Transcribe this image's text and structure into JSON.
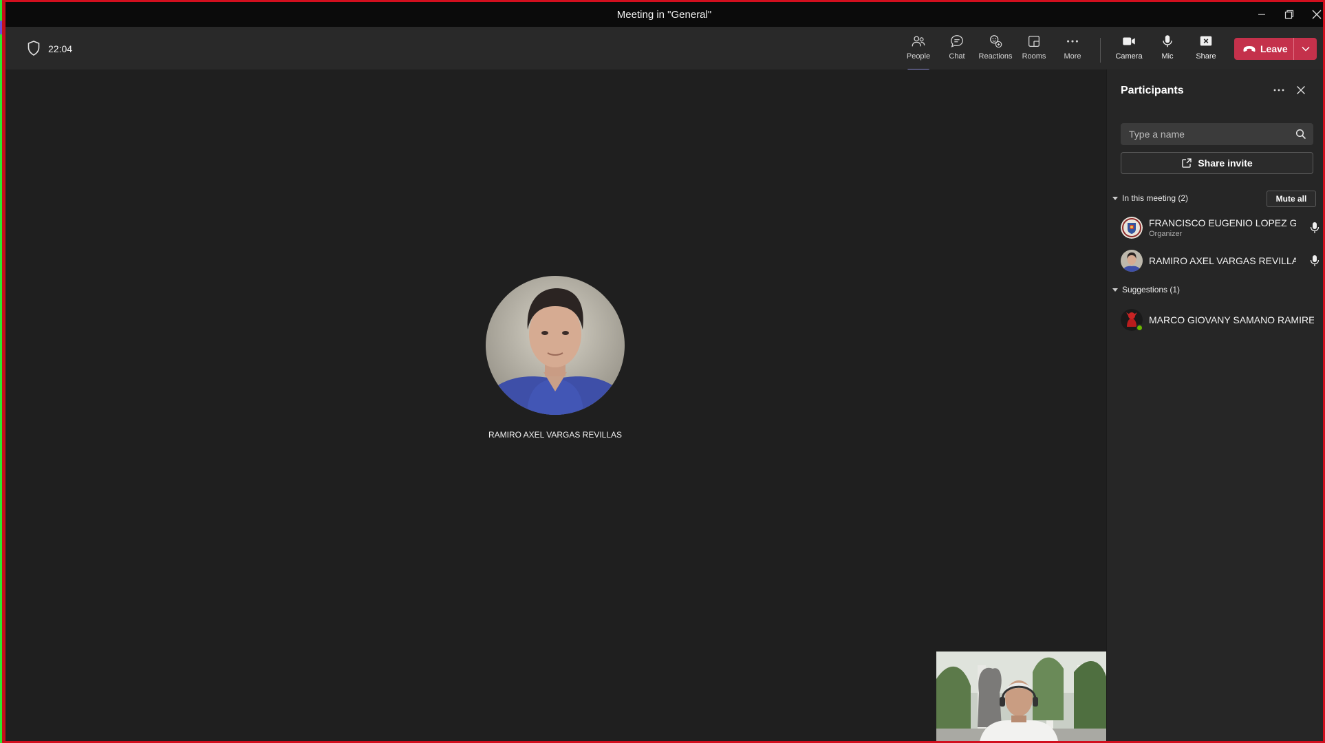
{
  "window": {
    "title": "Meeting in \"General\""
  },
  "toolbar": {
    "timer": "22:04",
    "buttons": [
      {
        "id": "people",
        "label": "People",
        "icon": "people-icon",
        "active": true
      },
      {
        "id": "chat",
        "label": "Chat",
        "icon": "chat-icon"
      },
      {
        "id": "reactions",
        "label": "Reactions",
        "icon": "reactions-icon"
      },
      {
        "id": "rooms",
        "label": "Rooms",
        "icon": "rooms-icon"
      },
      {
        "id": "more",
        "label": "More",
        "icon": "more-icon"
      },
      {
        "id": "camera",
        "label": "Camera",
        "icon": "camera-icon"
      },
      {
        "id": "mic",
        "label": "Mic",
        "icon": "mic-icon"
      },
      {
        "id": "share",
        "label": "Share",
        "icon": "share-tray-icon"
      }
    ],
    "leave_label": "Leave"
  },
  "stage": {
    "participant_name": "RAMIRO AXEL VARGAS REVILLAS"
  },
  "participants_panel": {
    "title": "Participants",
    "search_placeholder": "Type a name",
    "share_invite_label": "Share invite",
    "in_meeting": {
      "heading": "In this meeting (2)",
      "mute_all_label": "Mute all",
      "people": [
        {
          "name": "FRANCISCO EUGENIO LOPEZ G...",
          "role": "Organizer"
        },
        {
          "name": "RAMIRO AXEL VARGAS REVILLAS",
          "role": ""
        }
      ]
    },
    "suggestions": {
      "heading": "Suggestions (1)",
      "people": [
        {
          "name": "MARCO GIOVANY SAMANO RAMIREZ",
          "status": "available"
        }
      ]
    }
  },
  "colors": {
    "leave": "#c4314b",
    "active_tab": "#8b8cd6",
    "available": "#6bb700"
  }
}
